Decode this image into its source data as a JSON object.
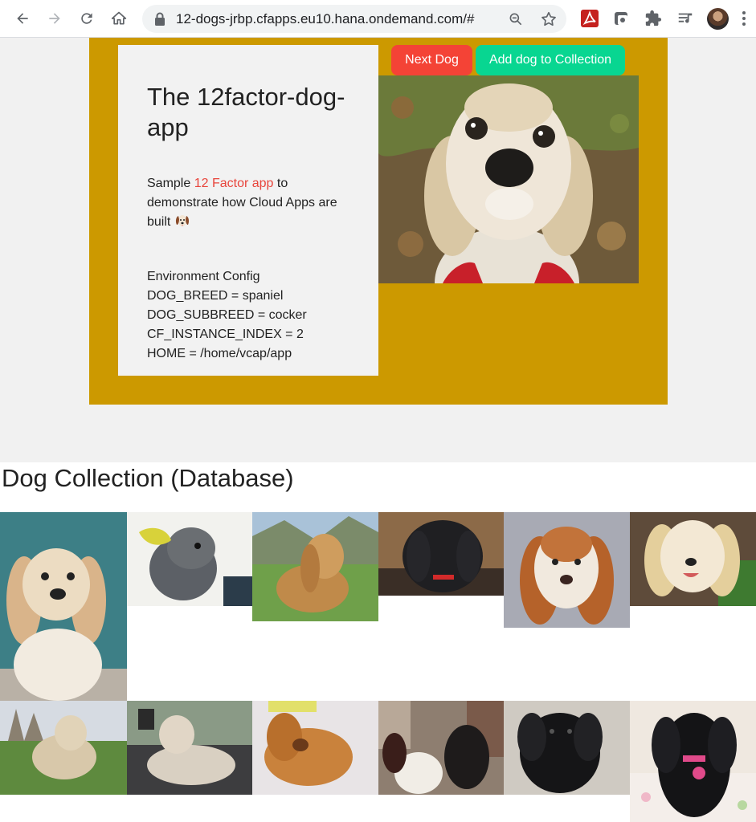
{
  "browser": {
    "url": "12-dogs-jrbp.cfapps.eu10.hana.ondemand.com/#",
    "icons": [
      "back-icon",
      "forward-icon",
      "reload-icon",
      "home-icon",
      "lock-icon",
      "zoom-icon",
      "star-icon",
      "pdf-extension-icon",
      "extension-icon",
      "puzzle-icon",
      "media-queue-icon",
      "profile-avatar",
      "menu-icon"
    ]
  },
  "hero": {
    "title": "The 12factor-dog-app",
    "desc_prefix": "Sample ",
    "desc_link": "12 Factor app",
    "desc_suffix": " to demonstrate how Cloud Apps are built",
    "env_heading": "Environment Config",
    "env": [
      "DOG_BREED = spaniel",
      "DOG_SUBBREED = cocker",
      "CF_INSTANCE_INDEX = 2",
      "HOME = /home/vcap/app"
    ],
    "next_label": "Next Dog",
    "add_label": "Add dog to Collection"
  },
  "colors": {
    "hero_bg": "#cc9900",
    "next_button": "#f44336",
    "add_button": "#08d691",
    "link": "#e8453c"
  },
  "collection": {
    "title": "Dog Collection (Database)",
    "photo_count": 12
  }
}
